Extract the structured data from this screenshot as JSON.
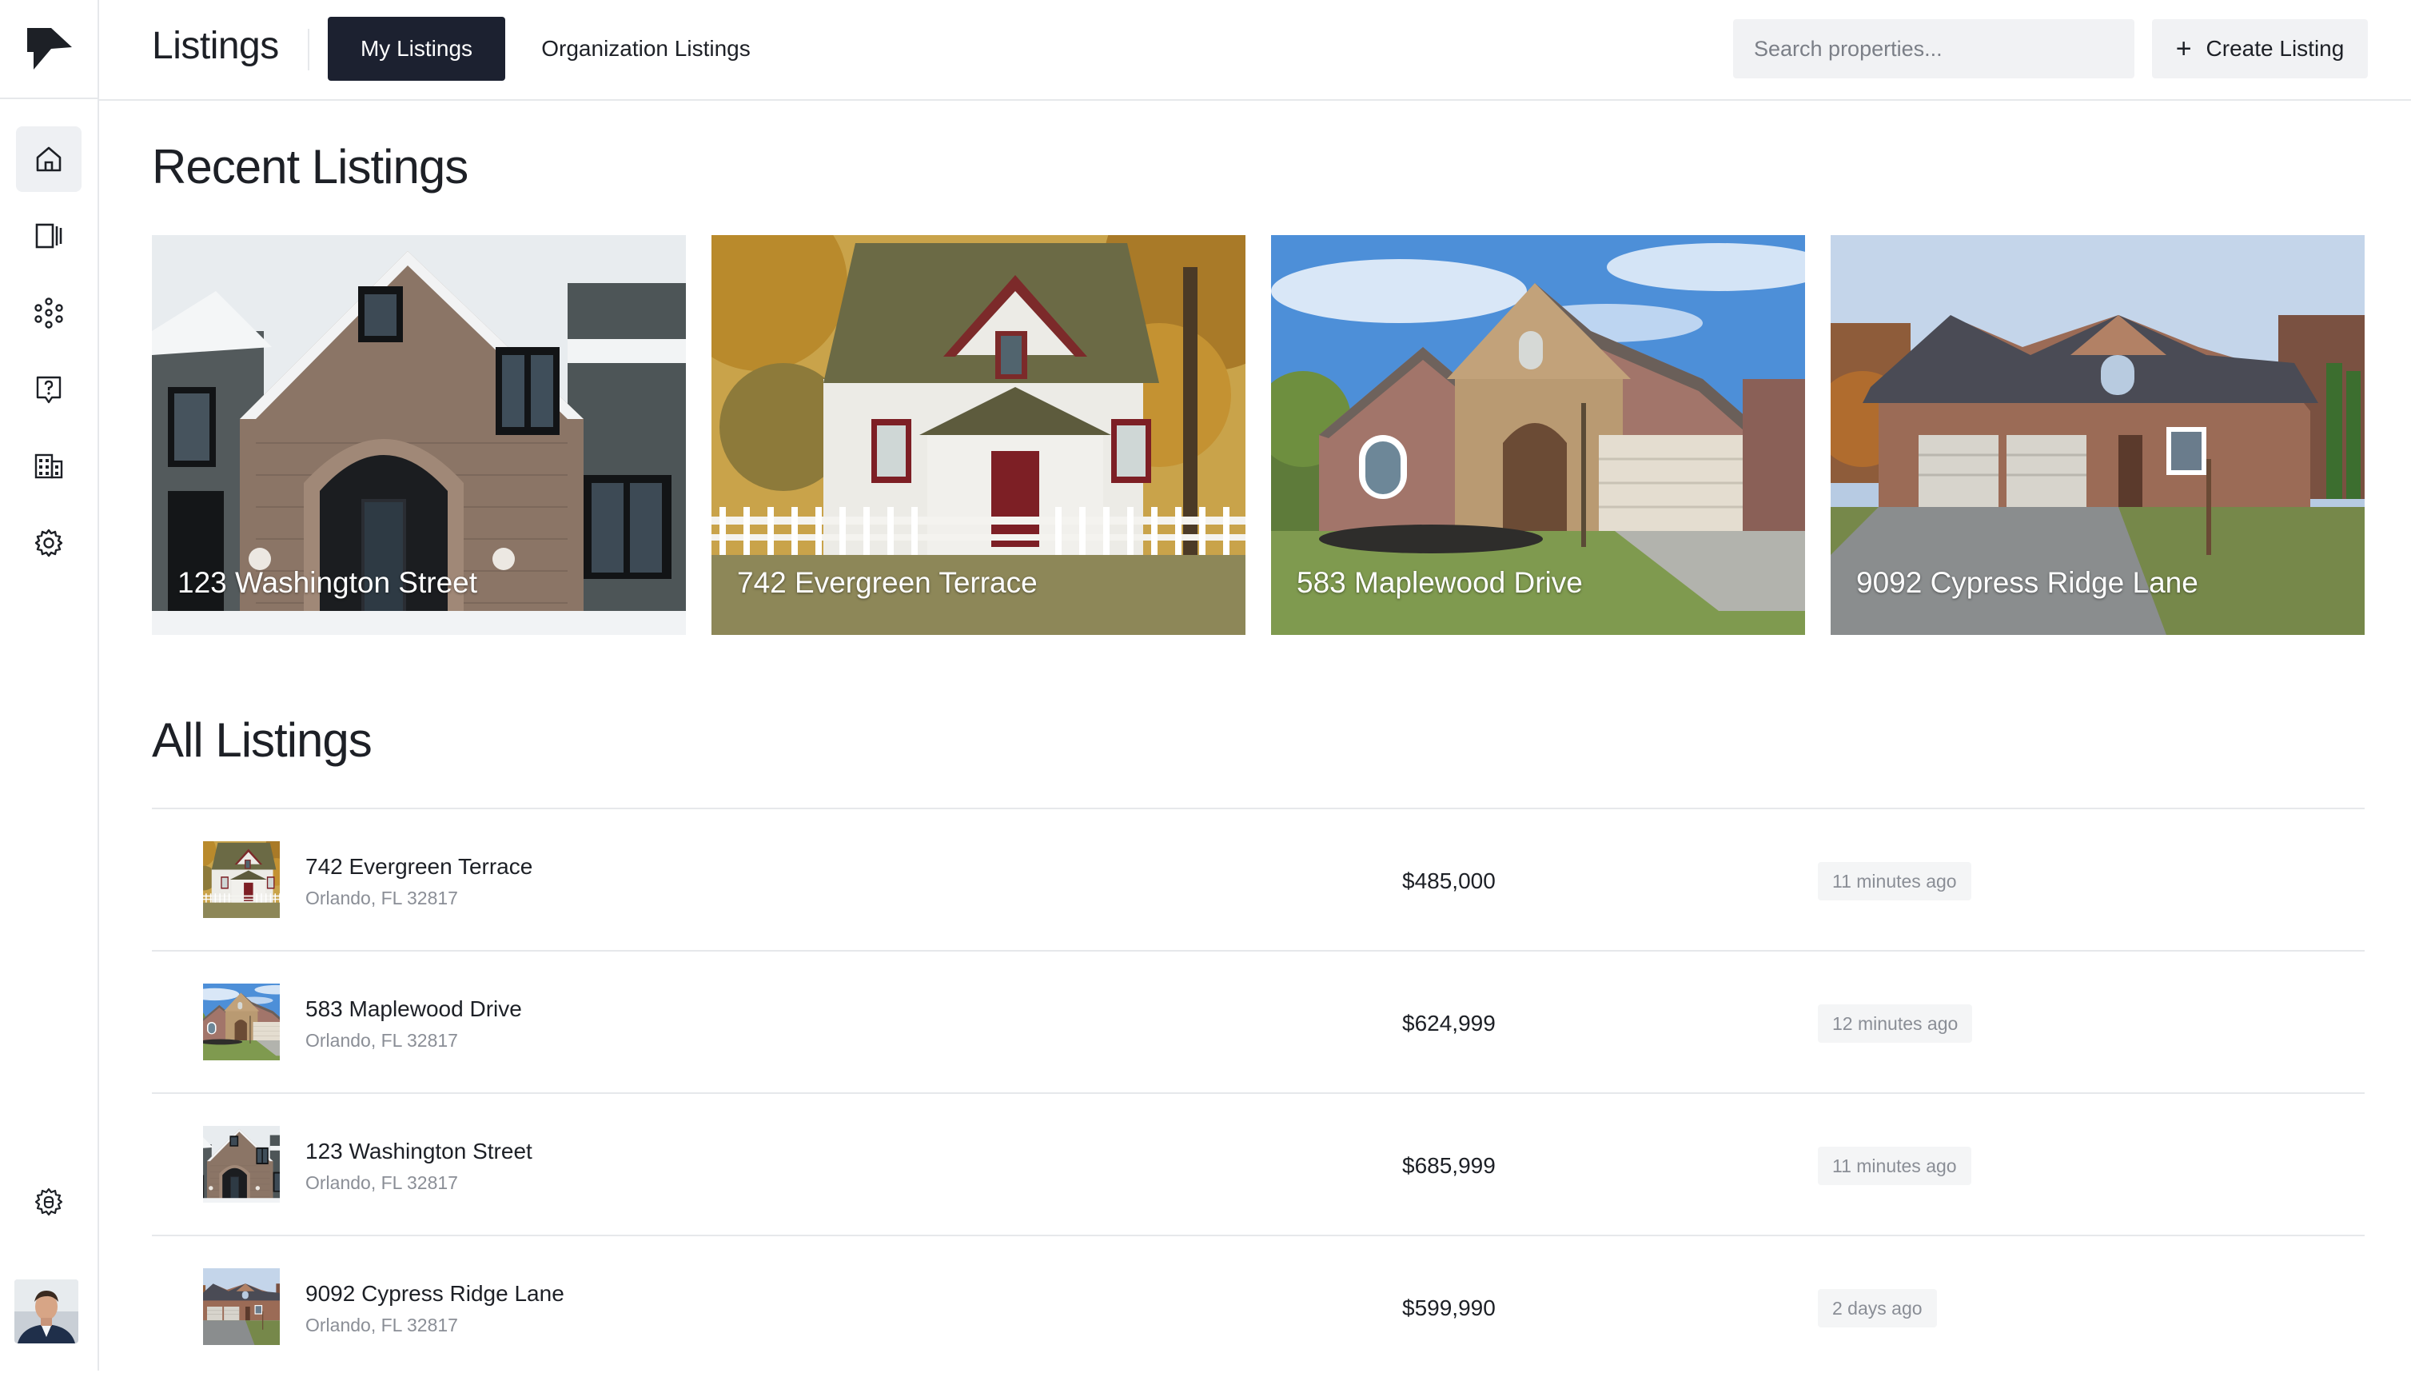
{
  "header": {
    "title": "Listings",
    "tabs": [
      "My Listings",
      "Organization Listings"
    ],
    "active_tab": "My Listings",
    "search_placeholder": "Search properties...",
    "create_label": "Create Listing",
    "create_icon": "plus-icon"
  },
  "sidebar": {
    "logo": "logo-icon",
    "items": [
      "home-icon",
      "listings-panel-icon",
      "network-icon",
      "help-icon",
      "buildings-icon",
      "settings-icon"
    ],
    "active_item": "home-icon",
    "bottom_items": [
      "bug-icon",
      "avatar"
    ]
  },
  "recent": {
    "title": "Recent Listings",
    "cards": [
      {
        "label": "123 Washington Street"
      },
      {
        "label": "742 Evergreen Terrace"
      },
      {
        "label": "583 Maplewood Drive"
      },
      {
        "label": "9092 Cypress Ridge Lane"
      }
    ]
  },
  "all": {
    "title": "All Listings",
    "rows": [
      {
        "title": "742 Evergreen Terrace",
        "location": "Orlando, FL 32817",
        "price": "$485,000",
        "time": "11 minutes ago"
      },
      {
        "title": "583 Maplewood Drive",
        "location": "Orlando, FL 32817",
        "price": "$624,999",
        "time": "12 minutes ago"
      },
      {
        "title": "123 Washington Street",
        "location": "Orlando, FL 32817",
        "price": "$685,999",
        "time": "11 minutes ago"
      },
      {
        "title": "9092 Cypress Ridge Lane",
        "location": "Orlando, FL 32817",
        "price": "$599,990",
        "time": "2 days ago"
      }
    ]
  },
  "colors": {
    "accent": "#1c2130",
    "border": "#e6e8eb",
    "muted_text": "#8a8e96",
    "chip_bg": "#f4f5f6"
  }
}
